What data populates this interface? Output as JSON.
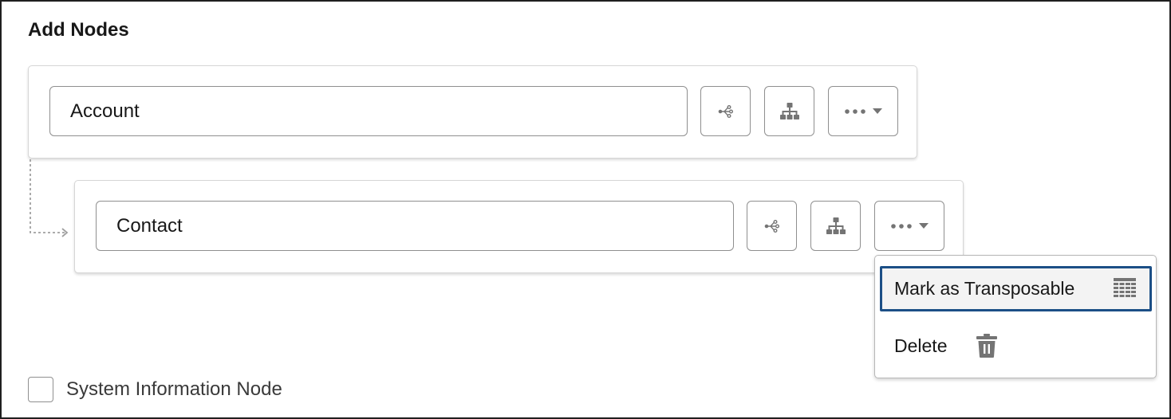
{
  "section": {
    "title": "Add Nodes"
  },
  "nodes": [
    {
      "value": "Account"
    },
    {
      "value": "Contact"
    }
  ],
  "icons": {
    "relationship": "relationship-tree-icon",
    "hierarchy": "hierarchy-icon",
    "more": "more-actions-icon",
    "chevron": "chevron-down-icon",
    "connector": "dotted-arrow-connector",
    "table": "table-grid-icon",
    "trash": "trash-icon"
  },
  "menu": {
    "items": [
      {
        "label": "Mark as Transposable"
      },
      {
        "label": "Delete"
      }
    ]
  },
  "system_node": {
    "label": "System Information Node",
    "checked": false
  },
  "colors": {
    "icon": "#747474",
    "border": "#8f8f8f",
    "focus": "#1c4f86",
    "connector": "#a0a0a0"
  }
}
